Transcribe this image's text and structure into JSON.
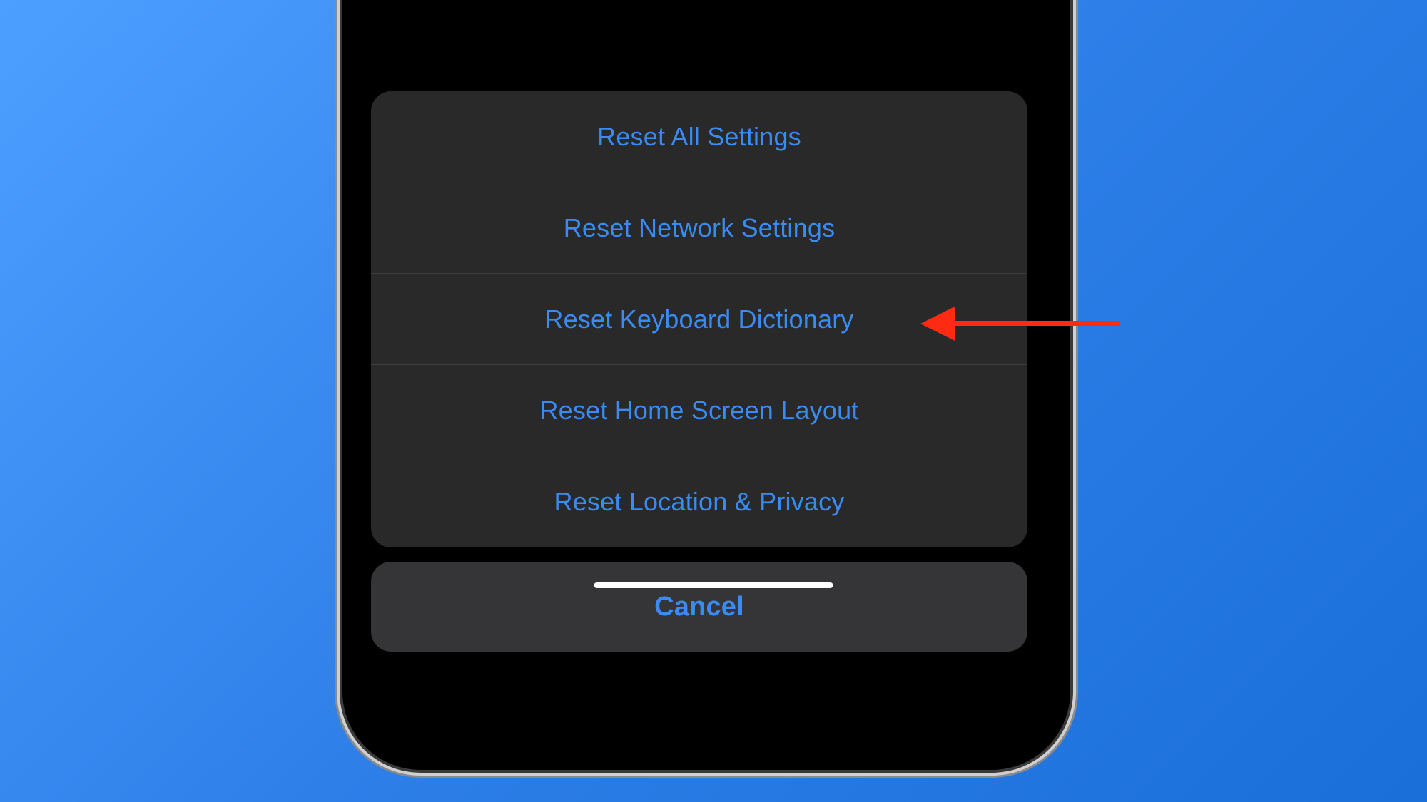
{
  "actionSheet": {
    "options": [
      {
        "label": "Reset All Settings"
      },
      {
        "label": "Reset Network Settings"
      },
      {
        "label": "Reset Keyboard Dictionary"
      },
      {
        "label": "Reset Home Screen Layout"
      },
      {
        "label": "Reset Location & Privacy"
      }
    ],
    "cancel_label": "Cancel"
  },
  "annotation": {
    "target": "Reset Keyboard Dictionary",
    "color": "#ff2a12"
  },
  "colors": {
    "accent": "#3a8cf5",
    "sheet_bg": "#2c2c2e",
    "cancel_bg": "#3a3a3c"
  }
}
